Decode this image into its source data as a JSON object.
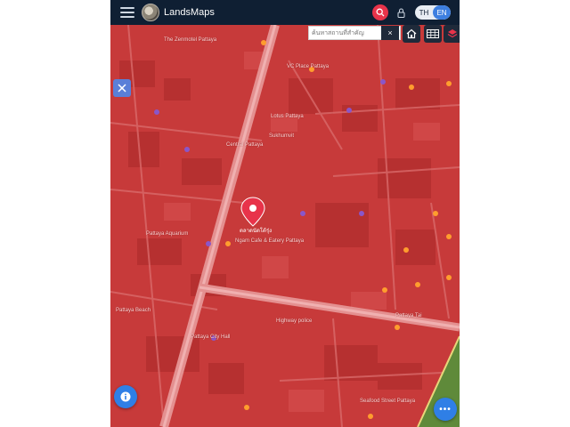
{
  "header": {
    "app_title": "LandsMaps",
    "lang_options": [
      "TH",
      "EN"
    ],
    "lang_active": "EN",
    "search_accent": "#e8334a",
    "bar_color": "#0f1f33"
  },
  "search": {
    "placeholder": "ค้นหาสถานที่สำคัญ",
    "clear_label": "×"
  },
  "map": {
    "overlay_color": "#c73a3a",
    "labels": [
      "The Zenmotel Pattaya",
      "VC Place Pattaya",
      "Lotus Pattaya",
      "Central Pattaya",
      "Pattaya Aquarium",
      "Pattaya Beach",
      "Pattaya City Hall",
      "Ngam Cafe & Eatery Pattaya",
      "Highway police",
      "Seafood Street Pattaya",
      "Sukhumvit",
      "Pattaya Tai"
    ],
    "marker_label": "ตลาดนัดโต้รุ่ง"
  },
  "buttons": {
    "more_label": "•••"
  }
}
